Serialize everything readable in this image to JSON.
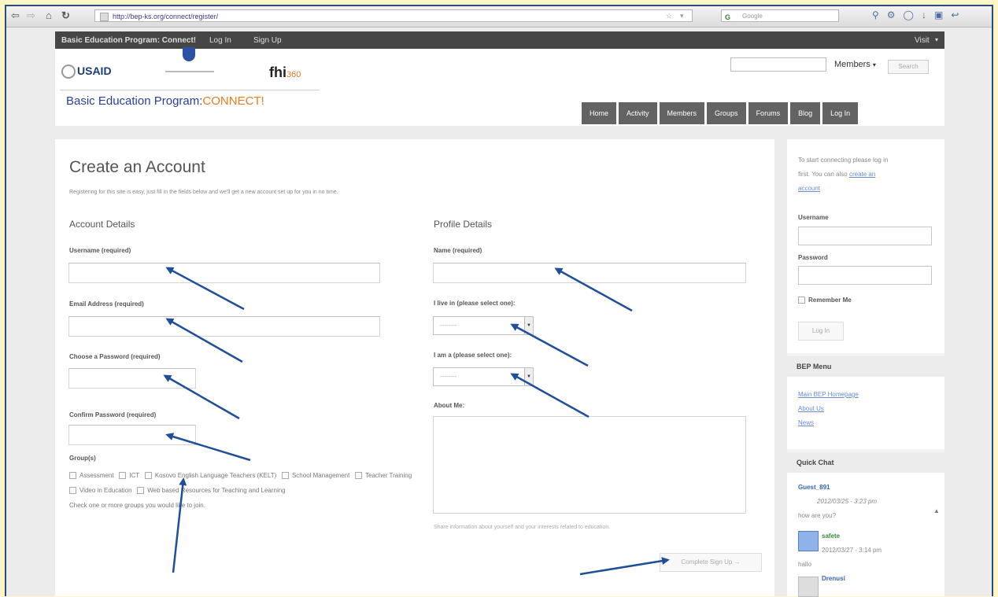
{
  "browser": {
    "url": "http://bep-ks.org/connect/register/",
    "search_placeholder": "Google",
    "search_engine": "G"
  },
  "adminbar": {
    "site": "Basic Education Program: Connect!",
    "login": "Log In",
    "signup": "Sign Up",
    "visit": "Visit"
  },
  "header": {
    "usaid": "USAID",
    "fhi": "fhi",
    "fhi_suffix": "360",
    "title_main": "Basic Education Program:",
    "title_connect": "CONNECT!",
    "members_select": "Members",
    "search_button": "Search",
    "nav": [
      "Home",
      "Activity",
      "Members",
      "Groups",
      "Forums",
      "Blog",
      "Log In"
    ]
  },
  "form": {
    "title": "Create an Account",
    "intro": "Registering for this site is easy, just fill in the fields below and we'll get a new account set up for you in no time.",
    "account_heading": "Account Details",
    "profile_heading": "Profile Details",
    "username_label": "Username (required)",
    "email_label": "Email Address (required)",
    "password_label": "Choose a Password (required)",
    "confirm_label": "Confirm Password (required)",
    "groups_label": "Group(s)",
    "groups": [
      "Assessment",
      "ICT",
      "Kosovo English Language Teachers (KELT)",
      "School Management",
      "Teacher Training",
      "Video in Education",
      "Web based Resources for Teaching and Learning"
    ],
    "groups_hint": "Check one or more groups you would like to join.",
    "name_label": "Name (required)",
    "live_label": "I live in (please select one):",
    "iam_label": "I am a (please select one):",
    "select_value": "--------",
    "about_label": "About Me:",
    "about_hint": "Share information about yourself and your interests related to education.",
    "submit": "Complete Sign Up →"
  },
  "sidebar": {
    "login_text_1": "To start connecting please log in",
    "login_text_2": "first. You can also",
    "create_link_1": "create an",
    "create_link_2": "account",
    "username_label": "Username",
    "password_label": "Password",
    "remember": "Remember Me",
    "login_button": "Log In",
    "menu_heading": "BEP Menu",
    "menu_items": [
      "Main BEP Homepage",
      "About Us",
      "News"
    ],
    "chat_heading": "Quick Chat",
    "chat": [
      {
        "user": "Guest_891",
        "time": "2012/03/25 - 3:23 pm",
        "message": "how are you?"
      },
      {
        "user": "safete",
        "time": "2012/03/27 - 3:14 pm",
        "message": "hallo"
      },
      {
        "user": "Drenusi",
        "time": "",
        "message": ""
      }
    ]
  },
  "colors": {
    "annotation_arrow": "#1f4e9a",
    "nav_button": "#636363",
    "connect_orange": "#f07a20"
  }
}
